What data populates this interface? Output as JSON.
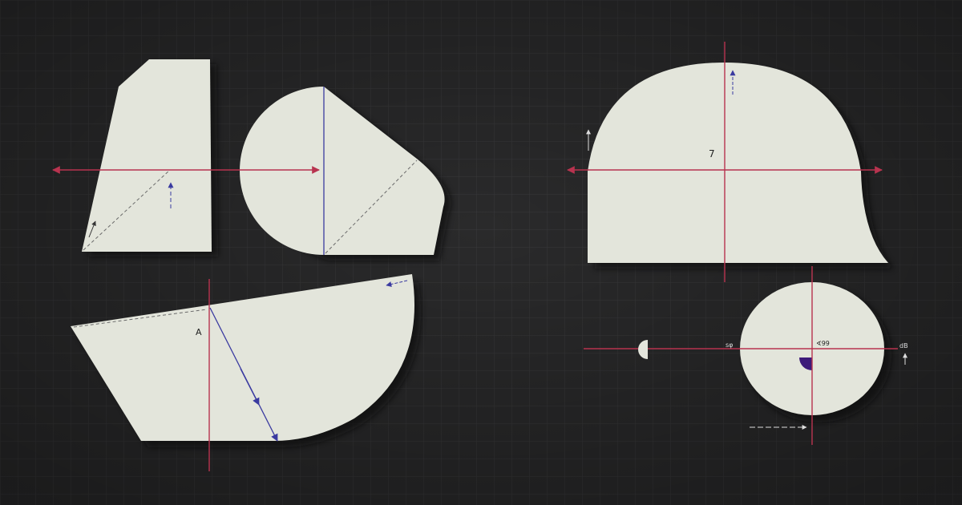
{
  "colors": {
    "background": "#2a2a2b",
    "grid": "#3a3a3c",
    "paper": "#e3e5db",
    "shadow": "#0d0d0e",
    "red_line": "#b8334f",
    "blue_line": "#3a3aa0",
    "dashed_line": "#6a6a6a",
    "wedge_fill": "#3d1a7a"
  },
  "labels": {
    "bottom_left_letter": "A",
    "top_right_number": "7",
    "circle_center_label": "∢99",
    "circle_left_label": "sφ",
    "right_edge_label": "dB"
  }
}
